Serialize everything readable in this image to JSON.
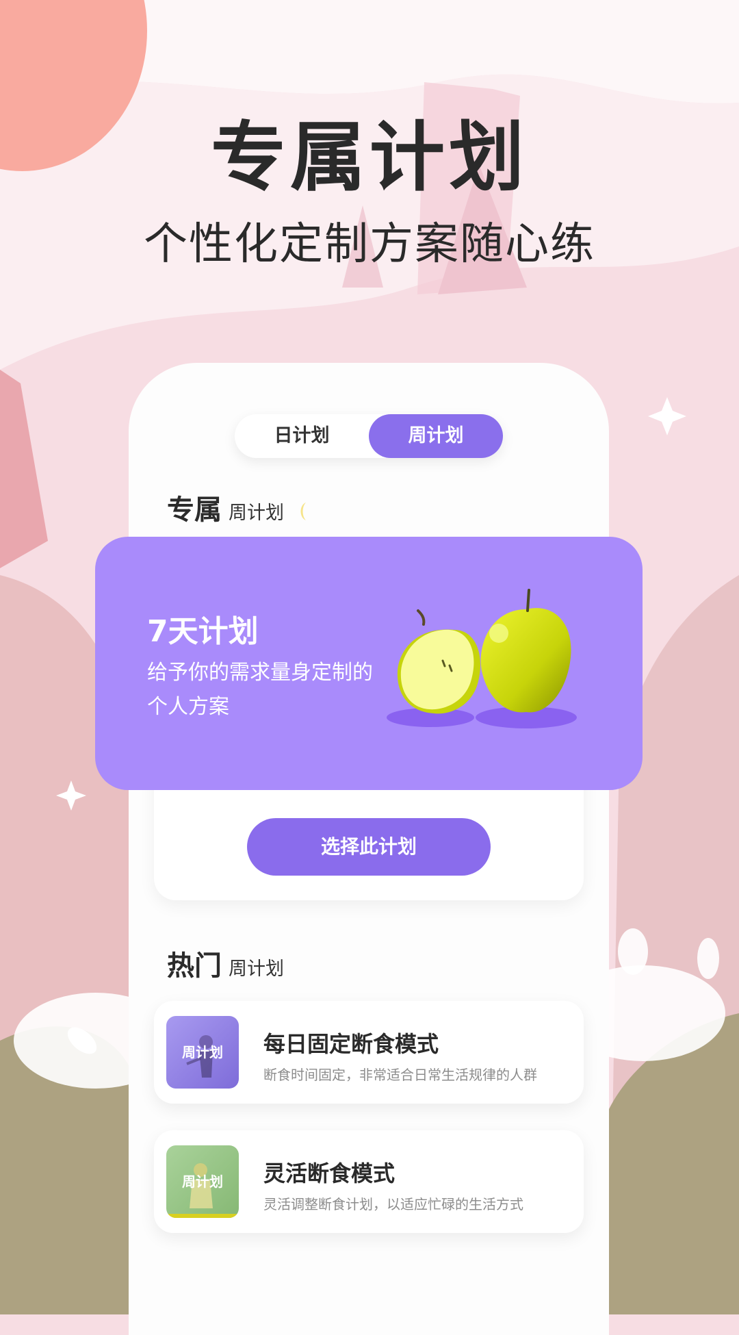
{
  "hero": {
    "title": "专属计划",
    "subtitle": "个性化定制方案随心练"
  },
  "toggle": {
    "day_label": "日计划",
    "week_label": "周计划",
    "selected": "周计划"
  },
  "exclusive_section": {
    "heading": "专属",
    "subheading": "周计划"
  },
  "featured_plan": {
    "title": "7天计划",
    "description": "给予你的需求量身定制的个人方案",
    "image_icon": "green-apples-illustration"
  },
  "select_button_label": "选择此计划",
  "popular_section": {
    "heading": "热门",
    "subheading": "周计划"
  },
  "plans": [
    {
      "thumb_label": "周计划",
      "name": "每日固定断食模式",
      "desc": "断食时间固定，非常适合日常生活规律的人群"
    },
    {
      "thumb_label": "周计划",
      "name": "灵活断食模式",
      "desc": "灵活调整断食计划，以适应忙碌的生活方式"
    }
  ],
  "colors": {
    "accent_purple": "#8a6cec",
    "card_purple": "#a98bfb",
    "coral": "#f9aa9f",
    "background_pink": "#f7dde3"
  }
}
